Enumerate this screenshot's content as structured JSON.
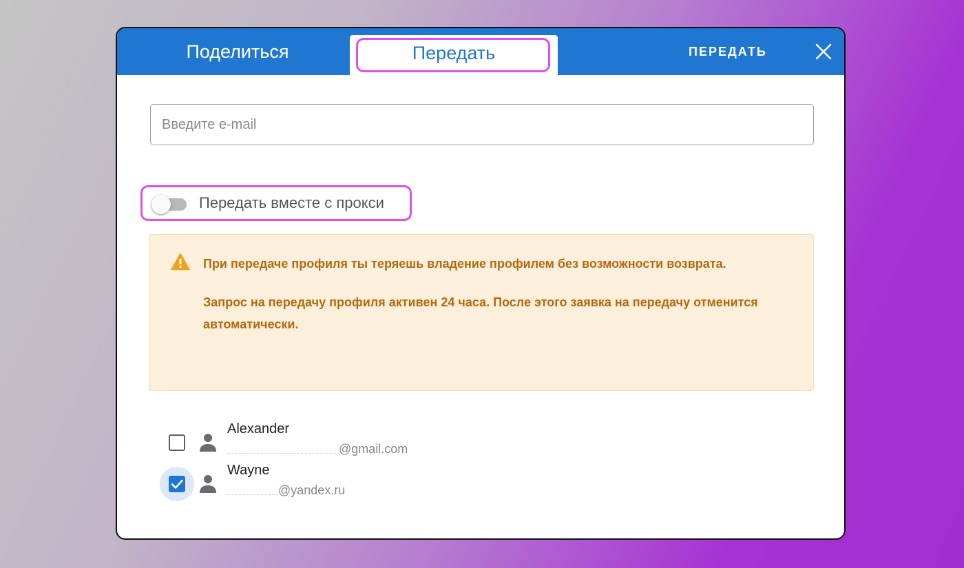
{
  "dialog": {
    "tabs": [
      {
        "label": "Поделиться",
        "active": false
      },
      {
        "label": "Передать",
        "active": true
      }
    ],
    "action_label": "ПЕРЕДАТЬ",
    "close_icon": "close-icon"
  },
  "email_field": {
    "placeholder": "Введите e-mail",
    "value": ""
  },
  "proxy_toggle": {
    "label": "Передать вместе с прокси",
    "on": false
  },
  "warning": {
    "icon": "warning-icon",
    "paragraphs": [
      "При передаче профиля ты теряешь владение профилем без возможности возврата.",
      "Запрос на передачу профиля активен 24 часа. После этого заявка на передачу отменится автоматически."
    ]
  },
  "users": [
    {
      "name": "Alexander",
      "email": "@gmail.com",
      "checked": false
    },
    {
      "name": "Wayne",
      "email": "@yandex.ru",
      "checked": true
    }
  ],
  "colors": {
    "primary": "#1f77d2",
    "highlight": "#e24ee8",
    "warning_bg": "#fcf0dc",
    "warning_text": "#b36a0e",
    "warning_icon": "#f0a21b"
  }
}
